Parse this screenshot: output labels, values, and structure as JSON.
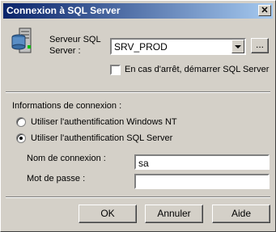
{
  "window": {
    "title": "Connexion à SQL Server",
    "close_glyph": "✕"
  },
  "server": {
    "label_line1": "Serveur SQL",
    "label_line2": "Server :",
    "value": "SRV_PROD",
    "browse_label": "...",
    "autostart_label": "En cas d'arrêt, démarrer SQL Server",
    "autostart_checked": false
  },
  "connection": {
    "group_label": "Informations de connexion :",
    "auth_windows_label": "Utiliser l'authentification Windows NT",
    "auth_sql_label": "Utiliser l'authentification SQL Server",
    "selected": "sql",
    "login_label": "Nom de connexion :",
    "login_value": "sa",
    "password_label": "Mot de passe :",
    "password_value": ""
  },
  "buttons": {
    "ok": "OK",
    "cancel": "Annuler",
    "help": "Aide"
  },
  "icons": {
    "server_icon": "server-database-icon",
    "combo_arrow": "chevron-down-icon"
  }
}
